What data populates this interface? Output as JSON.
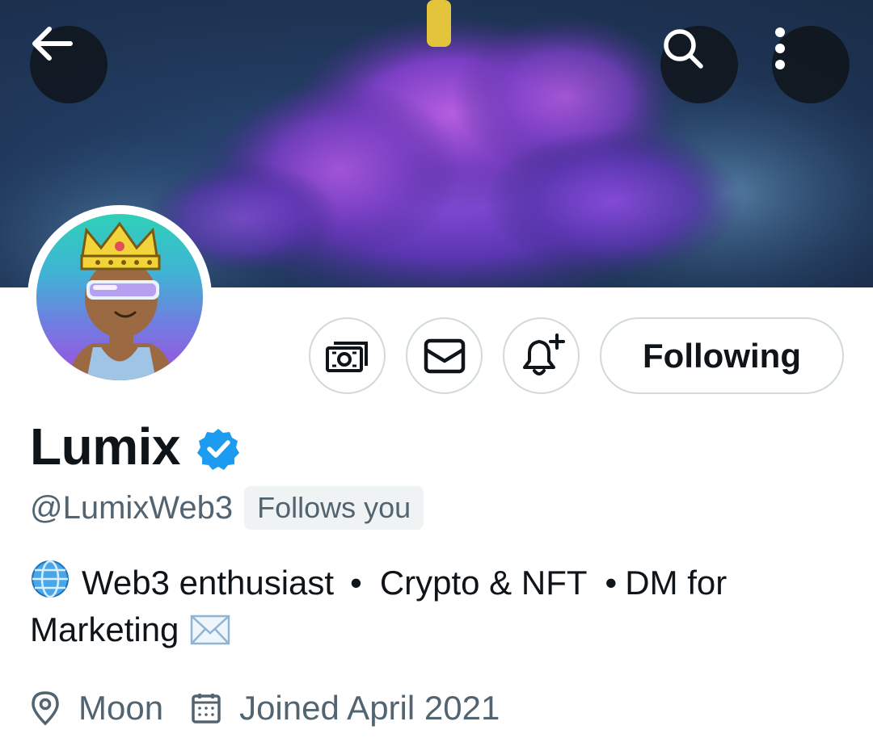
{
  "header": {
    "back_icon": "arrow-left-icon",
    "search_icon": "search-icon",
    "more_icon": "more-vertical-icon"
  },
  "profile": {
    "display_name": "Lumix",
    "verified": true,
    "handle": "@LumixWeb3",
    "follows_you": "Follows you",
    "bio": {
      "part1": "Web3 enthusiast",
      "separator": "•",
      "part2": "Crypto & NFT",
      "part3": "DM for Marketing",
      "emoji_start": "globe-icon",
      "emoji_end": "envelope-icon"
    },
    "location": "Moon",
    "joined": "Joined April 2021"
  },
  "actions": {
    "tip_icon": "money-icon",
    "message_icon": "envelope-icon",
    "notify_icon": "bell-plus-icon",
    "following_label": "Following"
  },
  "colors": {
    "verified_blue": "#1d9bf0",
    "secondary_text": "#536471",
    "border": "#cfd9de"
  }
}
